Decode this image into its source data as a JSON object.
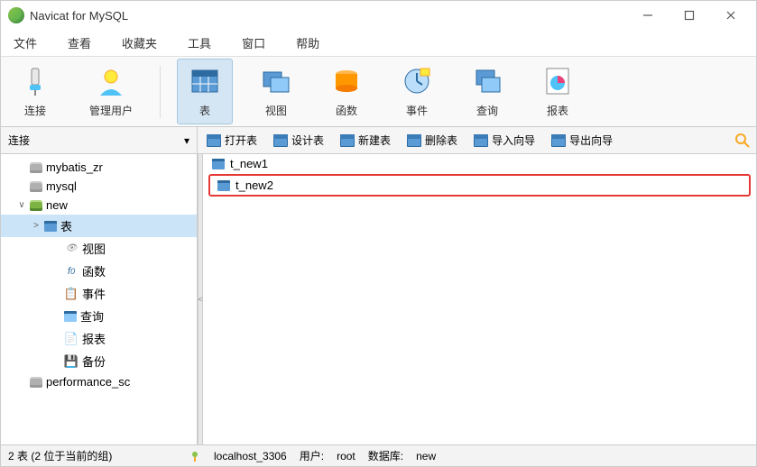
{
  "title": "Navicat for MySQL",
  "menu": [
    "文件",
    "查看",
    "收藏夹",
    "工具",
    "窗口",
    "帮助"
  ],
  "toolbar": [
    {
      "label": "连接",
      "active": false,
      "icon": "plug"
    },
    {
      "label": "管理用户",
      "active": false,
      "icon": "user"
    },
    {
      "label": "表",
      "active": true,
      "icon": "table"
    },
    {
      "label": "视图",
      "active": false,
      "icon": "view"
    },
    {
      "label": "函数",
      "active": false,
      "icon": "func"
    },
    {
      "label": "事件",
      "active": false,
      "icon": "event"
    },
    {
      "label": "查询",
      "active": false,
      "icon": "query"
    },
    {
      "label": "报表",
      "active": false,
      "icon": "report"
    }
  ],
  "subbar": {
    "left_label": "连接",
    "buttons": [
      "打开表",
      "设计表",
      "新建表",
      "删除表",
      "导入向导",
      "导出向导"
    ]
  },
  "tree": [
    {
      "label": "mybatis_zr",
      "icon": "db-grey",
      "indent": 0,
      "toggle": ""
    },
    {
      "label": "mysql",
      "icon": "db-grey",
      "indent": 0,
      "toggle": ""
    },
    {
      "label": "new",
      "icon": "db-green",
      "indent": 0,
      "toggle": "∨"
    },
    {
      "label": "表",
      "icon": "table",
      "indent": 1,
      "toggle": ">",
      "selected": true
    },
    {
      "label": "视图",
      "icon": "view",
      "indent": 2,
      "toggle": ""
    },
    {
      "label": "函数",
      "icon": "func",
      "indent": 2,
      "toggle": ""
    },
    {
      "label": "事件",
      "icon": "event",
      "indent": 2,
      "toggle": ""
    },
    {
      "label": "查询",
      "icon": "query",
      "indent": 2,
      "toggle": ""
    },
    {
      "label": "报表",
      "icon": "report",
      "indent": 2,
      "toggle": ""
    },
    {
      "label": "备份",
      "icon": "backup",
      "indent": 2,
      "toggle": ""
    },
    {
      "label": "performance_sc",
      "icon": "db-grey",
      "indent": 0,
      "toggle": ""
    }
  ],
  "content": {
    "items": [
      {
        "label": "t_new1",
        "highlighted": false
      },
      {
        "label": "t_new2",
        "highlighted": true
      }
    ]
  },
  "watermark": "",
  "status": {
    "left": "2 表 (2 位于当前的组)",
    "conn": "localhost_3306",
    "user_label": "用户:",
    "user_val": "root",
    "db_label": "数据库:",
    "db_val": "new"
  }
}
